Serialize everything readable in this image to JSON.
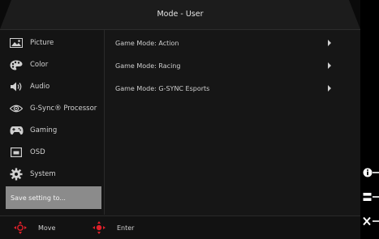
{
  "title": "Mode - User",
  "sidebar": {
    "items": [
      {
        "label": "Picture",
        "icon": "picture-icon"
      },
      {
        "label": "Color",
        "icon": "color-palette-icon"
      },
      {
        "label": "Audio",
        "icon": "speaker-icon"
      },
      {
        "label": "G-Sync® Processor",
        "icon": "gsync-eye-icon"
      },
      {
        "label": "Gaming",
        "icon": "gamepad-icon"
      },
      {
        "label": "OSD",
        "icon": "osd-window-icon"
      },
      {
        "label": "System",
        "icon": "gear-icon"
      }
    ],
    "selected_label": "Save setting to..."
  },
  "main": {
    "items": [
      {
        "label": "Game Mode: Action"
      },
      {
        "label": "Game Mode: Racing"
      },
      {
        "label": "Game Mode: G-SYNC Esports"
      }
    ]
  },
  "footer": {
    "move_label": "Move",
    "enter_label": "Enter"
  },
  "right_buttons": [
    "info-icon",
    "menu-icon",
    "close-icon"
  ],
  "colors": {
    "accent_red": "#e0202a",
    "selected_bg": "#8b8b8b",
    "panel_bg": "#161616"
  }
}
